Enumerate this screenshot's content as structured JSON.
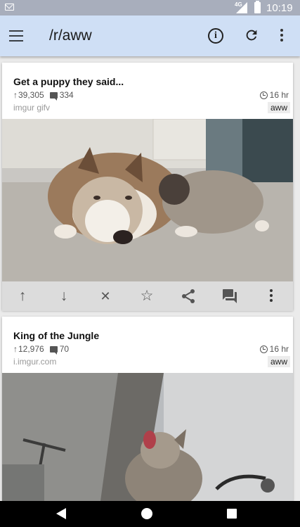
{
  "status_bar": {
    "network": "4G",
    "time": "10:19"
  },
  "toolbar": {
    "title": "/r/aww"
  },
  "posts": [
    {
      "title": "Get a puppy they said...",
      "upvotes": "39,305",
      "comments": "334",
      "domain": "imgur gifv",
      "time": "16 hr",
      "subreddit": "aww"
    },
    {
      "title": "King of the Jungle",
      "upvotes": "12,976",
      "comments": "70",
      "domain": "i.imgur.com",
      "time": "16 hr",
      "subreddit": "aww"
    }
  ],
  "icons": {
    "menu": "menu-icon",
    "info": "info-icon",
    "refresh": "refresh-icon",
    "overflow": "overflow-icon",
    "upvote": "↑",
    "downvote": "↓",
    "hide": "✕",
    "save": "☆"
  },
  "colors": {
    "toolbar": "#cfdff5",
    "status_bar": "#a8aebc",
    "action_bar": "#dcdcdc"
  }
}
